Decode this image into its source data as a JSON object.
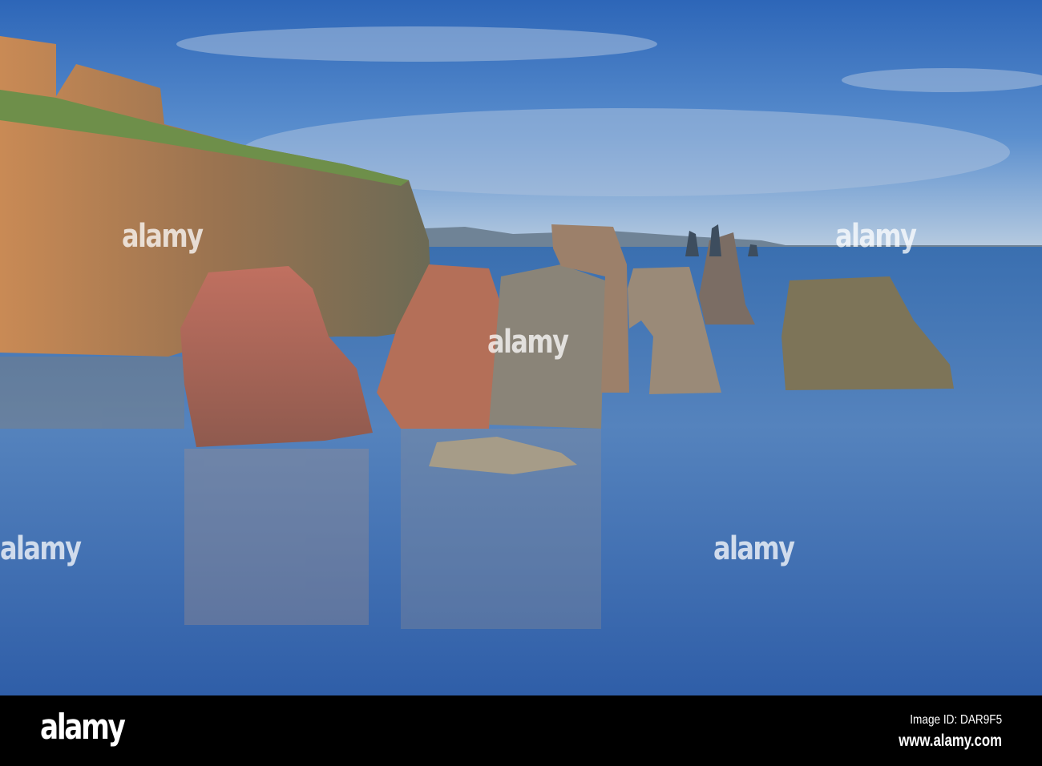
{
  "photo": {
    "subject": "Sea stacks and cliffs"
  },
  "watermark": {
    "text": "alamy"
  },
  "footer": {
    "logo": "alamy",
    "image_id": "Image ID: DAR9F5",
    "url": "www.alamy.com"
  }
}
